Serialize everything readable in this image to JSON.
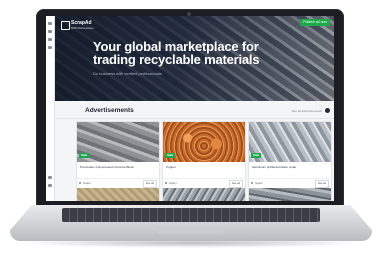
{
  "app": {
    "logo_name": "ScrapAd",
    "logo_tagline": "B2B Marketplace",
    "header_button": "Publish ad now"
  },
  "hero": {
    "title": "Your global marketplace for trading recyclable materials",
    "subtitle": "Do business with verified professionals"
  },
  "ads": {
    "section_title": "Advertisements",
    "see_all": "See all advertisements",
    "cards": [
      {
        "badge": "Sale",
        "title": "Pre-broken Compressed Concrete Block",
        "subtitle": "",
        "location": "Spain",
        "details_label": "See ad",
        "image": "concrete-blocks"
      },
      {
        "badge": "Sale",
        "title": "Copper",
        "subtitle": "",
        "location": "Spain",
        "details_label": "See ad",
        "image": "copper-wire"
      },
      {
        "badge": "Sale",
        "title": "Aluminium profile/extrusion scrap",
        "subtitle": "",
        "location": "Spain",
        "details_label": "See ad",
        "image": "aluminium-scrap"
      }
    ]
  },
  "colors": {
    "accent_green": "#1ea84b",
    "hero_dark": "#0e1626"
  }
}
